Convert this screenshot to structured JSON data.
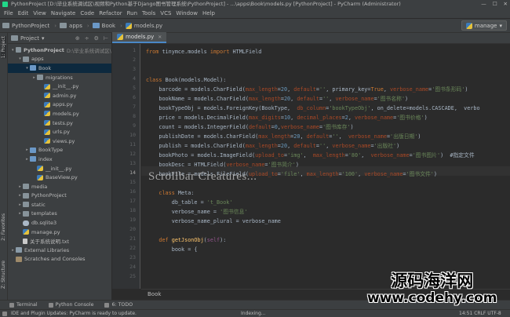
{
  "titlebar": {
    "text": "PythonProject [D:\\毕业系统调试区\\视频和Python基于Django图书管理系统\\PythonProject] - ...\\apps\\Book\\models.py [PythonProject] - PyCharm (Administrator)",
    "controls": [
      "—",
      "☐",
      "✕"
    ]
  },
  "menubar": {
    "items": [
      "File",
      "Edit",
      "View",
      "Navigate",
      "Code",
      "Refactor",
      "Run",
      "Tools",
      "VCS",
      "Window",
      "Help"
    ]
  },
  "navbar": {
    "crumbs": [
      "PythonProject",
      "apps",
      "Book",
      "models.py"
    ],
    "run_config": "manage"
  },
  "tool_strip": {
    "project": "1: Project",
    "favorites": "2: Favorites",
    "structure": "Z: Structure"
  },
  "project_panel": {
    "title": "Project",
    "tree": [
      {
        "label": "PythonProject",
        "suffix": "D:\\毕业系统调试区\\",
        "depth": 0,
        "arrow": "▾",
        "icon": "folder-g",
        "bold": true
      },
      {
        "label": "apps",
        "depth": 1,
        "arrow": "▾",
        "icon": "folder-g"
      },
      {
        "label": "Book",
        "depth": 2,
        "arrow": "▾",
        "icon": "folder-b",
        "selected": true
      },
      {
        "label": "migrations",
        "depth": 3,
        "arrow": "▸",
        "icon": "folder-g"
      },
      {
        "label": "__init__.py",
        "depth": 4,
        "arrow": "",
        "icon": "py"
      },
      {
        "label": "admin.py",
        "depth": 4,
        "arrow": "",
        "icon": "py"
      },
      {
        "label": "apps.py",
        "depth": 4,
        "arrow": "",
        "icon": "py"
      },
      {
        "label": "models.py",
        "depth": 4,
        "arrow": "",
        "icon": "py"
      },
      {
        "label": "tests.py",
        "depth": 4,
        "arrow": "",
        "icon": "py"
      },
      {
        "label": "urls.py",
        "depth": 4,
        "arrow": "",
        "icon": "py"
      },
      {
        "label": "views.py",
        "depth": 4,
        "arrow": "",
        "icon": "py"
      },
      {
        "label": "BookType",
        "depth": 2,
        "arrow": "▸",
        "icon": "folder-b"
      },
      {
        "label": "index",
        "depth": 2,
        "arrow": "▸",
        "icon": "folder-b"
      },
      {
        "label": "__init__.py",
        "depth": 3,
        "arrow": "",
        "icon": "py"
      },
      {
        "label": "BaseView.py",
        "depth": 3,
        "arrow": "",
        "icon": "py"
      },
      {
        "label": "media",
        "depth": 1,
        "arrow": "▸",
        "icon": "folder-g"
      },
      {
        "label": "PythonProject",
        "depth": 1,
        "arrow": "▸",
        "icon": "folder-g"
      },
      {
        "label": "static",
        "depth": 1,
        "arrow": "▸",
        "icon": "folder-g"
      },
      {
        "label": "templates",
        "depth": 1,
        "arrow": "▸",
        "icon": "folder-g"
      },
      {
        "label": "db.sqlite3",
        "depth": 1,
        "arrow": "",
        "icon": "db"
      },
      {
        "label": "manage.py",
        "depth": 1,
        "arrow": "",
        "icon": "py"
      },
      {
        "label": "关于系统说明.txt",
        "depth": 1,
        "arrow": "",
        "icon": "txt"
      },
      {
        "label": "External Libraries",
        "depth": 0,
        "arrow": "▸",
        "icon": "lib"
      },
      {
        "label": "Scratches and Consoles",
        "depth": 0,
        "arrow": "",
        "icon": "scratch"
      }
    ]
  },
  "editor": {
    "tab": "models.py",
    "line_numbers": [
      "1",
      "2",
      "3",
      "4",
      "5",
      "6",
      "7",
      "8",
      "9",
      "10",
      "11",
      "12",
      "13",
      "14",
      "15",
      "16",
      "17",
      "18",
      "19",
      "20",
      "21",
      "22",
      "23",
      "24",
      "25"
    ],
    "current_line": "14",
    "lines": [
      [
        [
          "kw",
          "from"
        ],
        [
          "tx",
          " tinymce.models "
        ],
        [
          "kw",
          "import"
        ],
        [
          "tx",
          " HTMLField"
        ]
      ],
      [],
      [],
      [
        [
          "kw",
          "class"
        ],
        [
          "tx",
          " Book(models.Model):"
        ]
      ],
      [
        [
          "tx",
          "    barcode = models.CharField("
        ],
        [
          "kwarg",
          "max_length"
        ],
        [
          "tx",
          "="
        ],
        [
          "num",
          "20"
        ],
        [
          "tx",
          ", "
        ],
        [
          "kwarg",
          "default"
        ],
        [
          "tx",
          "="
        ],
        [
          "str",
          "''"
        ],
        [
          "tx",
          ", primary_key="
        ],
        [
          "kw",
          "True"
        ],
        [
          "tx",
          ", "
        ],
        [
          "kwarg",
          "verbose_name"
        ],
        [
          "tx",
          "="
        ],
        [
          "str",
          "'图书条形码'"
        ],
        [
          "tx",
          ")"
        ]
      ],
      [
        [
          "tx",
          "    bookName = models.CharField("
        ],
        [
          "kwarg",
          "max_length"
        ],
        [
          "tx",
          "="
        ],
        [
          "num",
          "20"
        ],
        [
          "tx",
          ", "
        ],
        [
          "kwarg",
          "default"
        ],
        [
          "tx",
          "="
        ],
        [
          "str",
          "''"
        ],
        [
          "tx",
          ", "
        ],
        [
          "kwarg",
          "verbose_name"
        ],
        [
          "tx",
          "="
        ],
        [
          "str",
          "'图书名称'"
        ],
        [
          "tx",
          ")"
        ]
      ],
      [
        [
          "tx",
          "    bookTypeObj = models.ForeignKey(BookType,  "
        ],
        [
          "kwarg",
          "db_column"
        ],
        [
          "tx",
          "="
        ],
        [
          "str",
          "'bookTypeObj'"
        ],
        [
          "tx",
          ", on_delete=models.CASCADE,  verbo"
        ]
      ],
      [
        [
          "tx",
          "    price = models.DecimalField("
        ],
        [
          "kwarg",
          "max_digits"
        ],
        [
          "tx",
          "="
        ],
        [
          "num",
          "10"
        ],
        [
          "tx",
          ", "
        ],
        [
          "kwarg",
          "decimal_places"
        ],
        [
          "tx",
          "="
        ],
        [
          "num",
          "2"
        ],
        [
          "tx",
          ", "
        ],
        [
          "kwarg",
          "verbose_name"
        ],
        [
          "tx",
          "="
        ],
        [
          "str",
          "'图书价格'"
        ],
        [
          "tx",
          ")"
        ]
      ],
      [
        [
          "tx",
          "    count = models.IntegerField("
        ],
        [
          "kwarg",
          "default"
        ],
        [
          "tx",
          "="
        ],
        [
          "num",
          "0"
        ],
        [
          "tx",
          ","
        ],
        [
          "kwarg",
          "verbose_name"
        ],
        [
          "tx",
          "="
        ],
        [
          "str",
          "'图书库存'"
        ],
        [
          "tx",
          ")"
        ]
      ],
      [
        [
          "tx",
          "    publishDate = models.CharField("
        ],
        [
          "kwarg",
          "max_length"
        ],
        [
          "tx",
          "="
        ],
        [
          "num",
          "20"
        ],
        [
          "tx",
          ", "
        ],
        [
          "kwarg",
          "default"
        ],
        [
          "tx",
          "="
        ],
        [
          "str",
          "''"
        ],
        [
          "tx",
          ",  "
        ],
        [
          "kwarg",
          "verbose_name"
        ],
        [
          "tx",
          "="
        ],
        [
          "str",
          "'出版日期'"
        ],
        [
          "tx",
          ")"
        ]
      ],
      [
        [
          "tx",
          "    publish = models.CharField("
        ],
        [
          "kwarg",
          "max_length"
        ],
        [
          "tx",
          "="
        ],
        [
          "num",
          "20"
        ],
        [
          "tx",
          ", "
        ],
        [
          "kwarg",
          "default"
        ],
        [
          "tx",
          "="
        ],
        [
          "str",
          "''"
        ],
        [
          "tx",
          ", "
        ],
        [
          "kwarg",
          "verbose_name"
        ],
        [
          "tx",
          "="
        ],
        [
          "str",
          "'出版社'"
        ],
        [
          "tx",
          ")"
        ]
      ],
      [
        [
          "tx",
          "    bookPhoto = models.ImageField("
        ],
        [
          "kwarg",
          "upload_to"
        ],
        [
          "tx",
          "="
        ],
        [
          "str",
          "'img'"
        ],
        [
          "tx",
          ",  "
        ],
        [
          "kwarg",
          "max_length"
        ],
        [
          "tx",
          "="
        ],
        [
          "str",
          "'80'"
        ],
        [
          "tx",
          ",  "
        ],
        [
          "kwarg",
          "verbose_name"
        ],
        [
          "tx",
          "="
        ],
        [
          "str",
          "'图书图片'"
        ],
        [
          "tx",
          ")  #指定文件"
        ]
      ],
      [
        [
          "tx",
          "    bookDesc = HTMLField("
        ],
        [
          "kwarg",
          "verbose_name"
        ],
        [
          "tx",
          "="
        ],
        [
          "str",
          "'图书简介'"
        ],
        [
          "tx",
          ")"
        ]
      ],
      [
        [
          "tx",
          "    bookFile = models.FileField("
        ],
        [
          "kwarg",
          "upload_to"
        ],
        [
          "tx",
          "="
        ],
        [
          "str",
          "'file'"
        ],
        [
          "tx",
          ", "
        ],
        [
          "kwarg",
          "max_length"
        ],
        [
          "tx",
          "="
        ],
        [
          "str",
          "'100'"
        ],
        [
          "tx",
          ", "
        ],
        [
          "kwarg",
          "verbose_name"
        ],
        [
          "tx",
          "="
        ],
        [
          "str",
          "'图书文件'"
        ],
        [
          "tx",
          ")"
        ]
      ],
      [],
      [
        [
          "tx",
          "    "
        ],
        [
          "kw",
          "class"
        ],
        [
          "tx",
          " Meta:"
        ]
      ],
      [
        [
          "tx",
          "        db_table = "
        ],
        [
          "str",
          "'t_Book'"
        ]
      ],
      [
        [
          "tx",
          "        verbose_name = "
        ],
        [
          "str",
          "'图书信息'"
        ]
      ],
      [
        [
          "tx",
          "        verbose_name_plural = verbose_name"
        ]
      ],
      [],
      [
        [
          "tx",
          "    "
        ],
        [
          "kw",
          "def"
        ],
        [
          "tx",
          " "
        ],
        [
          "fn",
          "getJsonObj"
        ],
        [
          "tx",
          "("
        ],
        [
          "self",
          "self"
        ],
        [
          "tx",
          "):"
        ]
      ],
      [
        [
          "tx",
          "        book = {"
        ]
      ]
    ],
    "overlay_text": "Scrollbar Creatures...",
    "breadcrumb": "Book"
  },
  "bottom_tabs": [
    "Terminal",
    "Python Console",
    "6: TODO"
  ],
  "statusbar": {
    "message": "IDE and Plugin Updates: PyCharm is ready to update.",
    "indexing": "Indexing...",
    "time": "14:51   CRLF  UTF-8"
  },
  "watermark": {
    "line1": "源码海洋网",
    "line2": "www.codehy.com"
  }
}
